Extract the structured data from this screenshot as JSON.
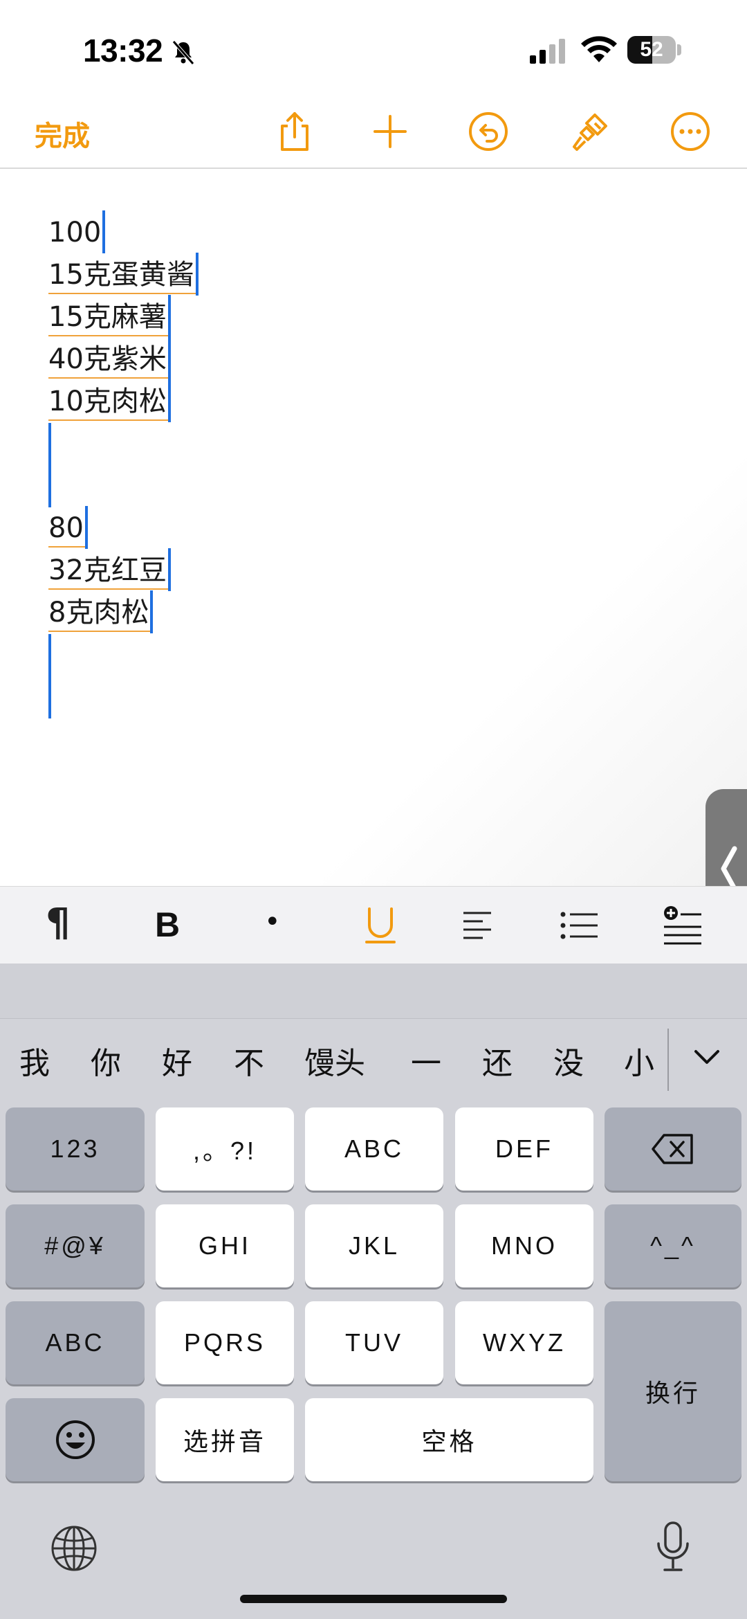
{
  "status_bar": {
    "time": "13:32",
    "battery_level": "52",
    "battery_fraction": 0.52
  },
  "toolbar": {
    "done_label": "完成",
    "accent_color": "#f29a0f",
    "icons": [
      "share-icon",
      "add-icon",
      "undo-icon",
      "format-brush-icon",
      "more-icon"
    ]
  },
  "document": {
    "lines": [
      {
        "text": "100",
        "underline": false
      },
      {
        "text": "15克蛋黄酱",
        "underline": true
      },
      {
        "text": "15克麻薯",
        "underline": true
      },
      {
        "text": "40克紫米",
        "underline": true
      },
      {
        "text": "10克肉松",
        "underline": true
      },
      {
        "text": "80",
        "underline": true
      },
      {
        "text": "32克红豆",
        "underline": true
      },
      {
        "text": "8克肉松",
        "underline": true
      }
    ],
    "cursor_color": "#1e6fe0"
  },
  "format_bar": {
    "pilcrow": "¶",
    "bold": "B",
    "bullet": "•",
    "underline": "U",
    "icons": [
      "paragraph-icon",
      "bold-icon",
      "bullet-icon",
      "underline-icon",
      "align-left-icon",
      "list-icon",
      "insert-list-icon"
    ]
  },
  "keyboard": {
    "candidates": [
      "我",
      "你",
      "好",
      "不",
      "馒头",
      "一",
      "还",
      "没",
      "小"
    ],
    "keys": {
      "num": "123",
      "punct": ",。?!",
      "abc_key": "ABC",
      "def": "DEF",
      "symbols": "#@¥",
      "ghi": "GHI",
      "jkl": "JKL",
      "mno": "MNO",
      "emoticon": "^_^",
      "abc_mode": "ABC",
      "pqrs": "PQRS",
      "tuv": "TUV",
      "wxyz": "WXYZ",
      "return": "换行",
      "select_pinyin": "选拼音",
      "space": "空格"
    }
  }
}
